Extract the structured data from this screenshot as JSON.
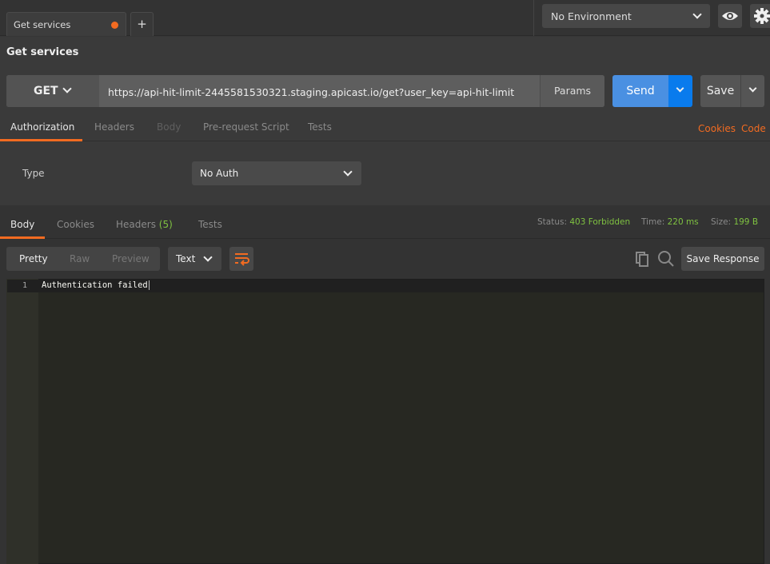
{
  "tabs": [
    {
      "label": "Get services",
      "unsaved": true
    }
  ],
  "new_tab_label": "+",
  "environment": {
    "selected": "No Environment"
  },
  "icons": {
    "eye": "eye-icon",
    "settings": "gear-icon",
    "copy": "copy-icon",
    "search": "search-icon",
    "wrap": "wrap-lines-icon"
  },
  "request": {
    "title": "Get services",
    "method": "GET",
    "url": "https://api-hit-limit-2445581530321.staging.apicast.io/get?user_key=api-hit-limit",
    "params_label": "Params",
    "send_label": "Send",
    "save_label": "Save"
  },
  "request_tabs": [
    "Authorization",
    "Headers",
    "Body",
    "Pre-request Script",
    "Tests"
  ],
  "request_links": {
    "cookies": "Cookies",
    "code": "Code"
  },
  "auth": {
    "type_label": "Type",
    "type_value": "No Auth"
  },
  "response_tabs": {
    "body": "Body",
    "cookies": "Cookies",
    "headers": "Headers",
    "headers_count": "(5)",
    "tests": "Tests"
  },
  "response_meta": {
    "status_label": "Status:",
    "status": "403 Forbidden",
    "time_label": "Time:",
    "time": "220 ms",
    "size_label": "Size:",
    "size": "199 B"
  },
  "format": {
    "pretty": "Pretty",
    "raw": "Raw",
    "preview": "Preview",
    "type": "Text",
    "save_response": "Save Response"
  },
  "body": {
    "line_number": "1",
    "content": "Authentication failed"
  },
  "colors": {
    "accent": "#f26b21",
    "send": "#4a90e2",
    "status_ok": "#7fc241"
  }
}
